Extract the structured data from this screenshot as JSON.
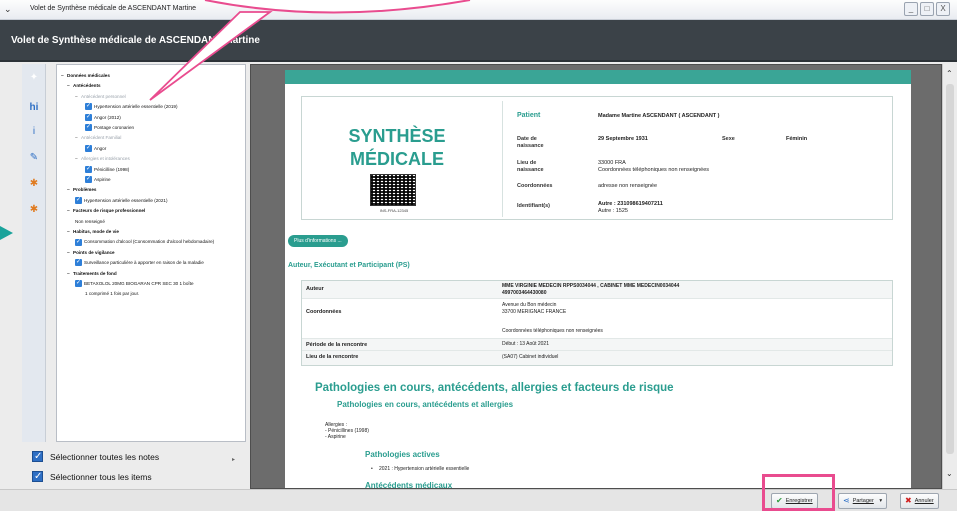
{
  "window": {
    "title": "Volet de Synthèse  médicale de ASCENDANT Martine",
    "controls": [
      "_",
      "□",
      "X"
    ]
  },
  "header": {
    "title": "Volet de Synthèse  médicale de ASCENDANT Martine"
  },
  "tree": [
    {
      "label": "Données médicales",
      "level": 0,
      "bold": true,
      "exp": "−"
    },
    {
      "label": "Antécédents",
      "level": 1,
      "bold": true,
      "exp": "−"
    },
    {
      "label": "Antécédent personnel",
      "level": 2,
      "grey": true,
      "exp": "−"
    },
    {
      "label": "Hypertension artérielle essentielle (2019)",
      "level": 3,
      "check": true
    },
    {
      "label": "Angor (2012)",
      "level": 3,
      "check": true
    },
    {
      "label": "Pontage coronarien",
      "level": 3,
      "check": true
    },
    {
      "label": "Antécédent Familial",
      "level": 2,
      "grey": true,
      "exp": "−"
    },
    {
      "label": "Angor",
      "level": 3,
      "check": true
    },
    {
      "label": "Allergies et intolérances",
      "level": 2,
      "grey": true,
      "exp": "−"
    },
    {
      "label": "Pénicilline (1998)",
      "level": 3,
      "check": true
    },
    {
      "label": "Aspirine",
      "level": 3,
      "check": true
    },
    {
      "label": "Problèmes",
      "level": 1,
      "bold": true,
      "exp": "−"
    },
    {
      "label": "Hypertension artérielle essentielle (2021)",
      "level": 2,
      "check": true
    },
    {
      "label": "Facteurs de risque professionnel",
      "level": 1,
      "bold": true,
      "exp": "−"
    },
    {
      "label": "Non renseigné",
      "level": 2
    },
    {
      "label": "Habitus, mode de vie",
      "level": 1,
      "bold": true,
      "exp": "−"
    },
    {
      "label": "Consommation d'alcool (Consommation d'alcool hebdomadaire)",
      "level": 2,
      "check": true
    },
    {
      "label": "Points de vigilance",
      "level": 1,
      "bold": true,
      "exp": "−"
    },
    {
      "label": "Surveillance particulière à apporter en raison de la maladie",
      "level": 2,
      "check": true
    },
    {
      "label": "Traitements de fond",
      "level": 1,
      "bold": true,
      "exp": "−"
    },
    {
      "label": "BETAXOLOL 20MG BIOGARAN CPR SEC 30  1 boîte",
      "level": 2,
      "check": true
    },
    {
      "label": "1 comprimé  1 fois par jour.",
      "level": 3
    }
  ],
  "select": {
    "all_notes": "Sélectionner toutes les notes",
    "all_items": "Sélectionner tous les items"
  },
  "doc": {
    "title_line1": "SYNTHÈSE",
    "title_line2": "MÉDICALE",
    "qr_caption": "INS-FRA-12345",
    "patient_label": "Patient",
    "patient_value": "Madame Martine ASCENDANT ( ASCENDANT )",
    "dob_label": "Date de naissance",
    "dob_value": "29 Septembre 1931",
    "sex_label": "Sexe",
    "sex_value": "Féminin",
    "pob_label": "Lieu de naissance",
    "pob_value1": "33000 FRA",
    "pob_value2": "Coordonnées téléphoniques non renseignées",
    "coord_label": "Coordonnées",
    "coord_value": "adresse non renseignée",
    "id_label": "Identifiant(s)",
    "id_value1": "Autre : 231098619407211",
    "id_value2": "Autre : 1525",
    "plus_info": "Plus d'informations ...",
    "actors_title": "Auteur, Exécutant et Participant (PS)",
    "author_label": "Auteur",
    "author_value1": "MME VIRGINIE MEDECIN RPPS0034044 , CABINET MME MEDECIN0034044",
    "author_value2": "4997003464430080",
    "coord2_label": "Coordonnées",
    "coord2_value1": "Avenue du Bon médecin",
    "coord2_value2": "33700 MERIGNAC FRANCE",
    "coord2_value3": "Coordonnées téléphoniques non renseignées",
    "period_label": "Période de la rencontre",
    "period_value": "Début :  13 Août 2021",
    "place_label": "Lieu de la rencontre",
    "place_value": "(SA07) Cabinet individuel",
    "path_title": "Pathologies en cours, antécédents, allergies et facteurs de risque",
    "path_sub": "Pathologies en cours, antécédents et allergies",
    "allergies_head": "Allergies :",
    "allergy1": "- Pénicillines (1998)",
    "allergy2": "- Aspirine",
    "actives_title": "Pathologies actives",
    "active1": "2021 : Hypertension artérielle essentielle",
    "antec_title": "Antécédents médicaux"
  },
  "toolbar": {
    "save": "Enregistrer",
    "share": "Partager",
    "cancel": "Annuler"
  },
  "colors": {
    "teal": "#2a9d8f",
    "annotation_pink": "#e94c8f",
    "header_bg": "#3b4248"
  }
}
